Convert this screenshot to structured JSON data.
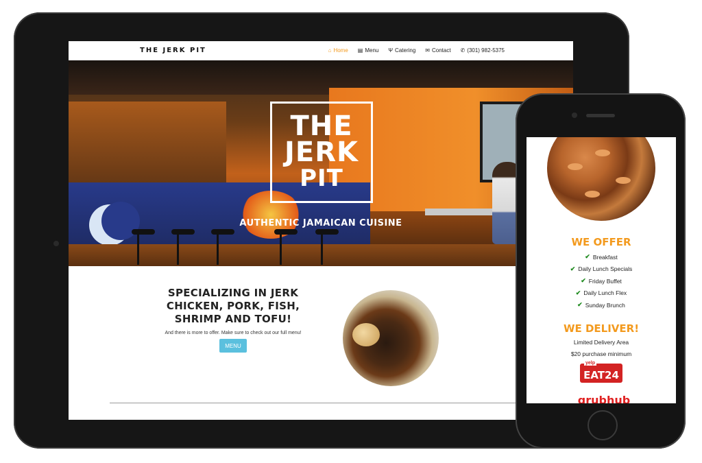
{
  "tablet": {
    "nav": {
      "brand": "THE JERK PIT",
      "links": [
        {
          "icon": "home-icon",
          "glyph": "⌂",
          "label": "Home"
        },
        {
          "icon": "menu-icon",
          "glyph": "▤",
          "label": "Menu"
        },
        {
          "icon": "utensils-icon",
          "glyph": "Ψ",
          "label": "Catering"
        },
        {
          "icon": "envelope-icon",
          "glyph": "✉",
          "label": "Contact"
        },
        {
          "icon": "phone-icon",
          "glyph": "✆",
          "label": "(301) 982-5375"
        }
      ]
    },
    "hero": {
      "logo_line1": "THE",
      "logo_line2": "JERK",
      "logo_line3": "PIT",
      "tagline": "AUTHENTIC JAMAICAN CUISINE"
    },
    "section": {
      "title": "SPECIALIZING IN JERK CHICKEN, PORK, FISH, SHRIMP AND TOFU!",
      "subtitle": "And there is more to offer. Make sure to check out our full menu!",
      "button": "MENU"
    }
  },
  "phone": {
    "offer_heading": "WE OFFER",
    "offer_items": [
      "Breakfast",
      "Daily Lunch Specials",
      "Friday Buffet",
      "Daily Lunch Flex",
      "Sunday Brunch"
    ],
    "deliver_heading": "WE DELIVER!",
    "deliver_line1": "Limited Delivery Area",
    "deliver_line2": "$20 purchase minimum",
    "yelp_label": "yelp",
    "eat24_label": "EAT24",
    "grubhub_label": "grubhub"
  },
  "colors": {
    "accent": "#f39a1e",
    "button": "#5bc0de",
    "check": "#1e8a1e",
    "eat24": "#d32323"
  }
}
